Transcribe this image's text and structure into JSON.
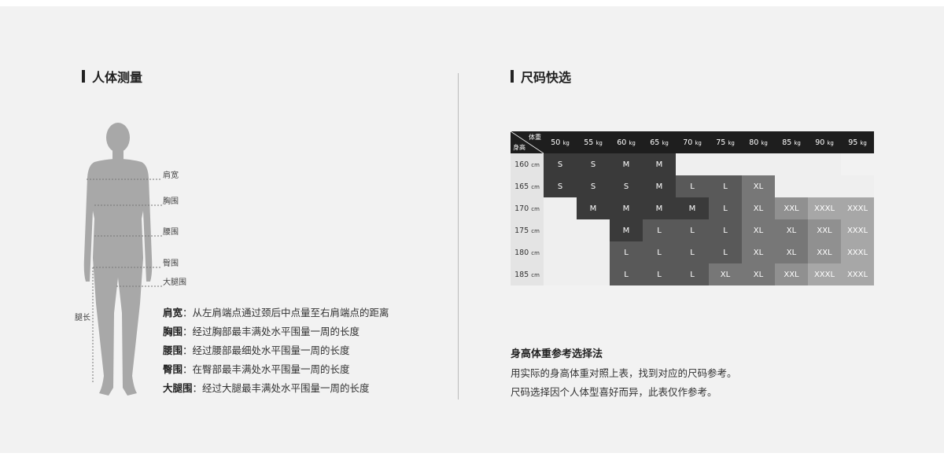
{
  "left": {
    "title": "人体测量",
    "labels": {
      "shoulder": "肩宽",
      "chest": "胸围",
      "waist": "腰围",
      "hip": "臀围",
      "thigh": "大腿围",
      "leg": "腿长"
    },
    "descriptions": [
      {
        "term": "肩宽",
        "text": "：从左肩端点通过颈后中点量至右肩端点的距离"
      },
      {
        "term": "胸围",
        "text": "：经过胸部最丰满处水平围量一周的长度"
      },
      {
        "term": "腰围",
        "text": "：经过腰部最细处水平围量一周的长度"
      },
      {
        "term": "臀围",
        "text": "：在臀部最丰满处水平围量一周的长度"
      },
      {
        "term": "大腿围",
        "text": "：经过大腿最丰满处水平围量一周的长度"
      }
    ]
  },
  "right": {
    "title": "尺码快选",
    "corner_weight": "体重",
    "corner_height": "身高",
    "weights": [
      "50",
      "55",
      "60",
      "65",
      "70",
      "75",
      "80",
      "85",
      "90",
      "95"
    ],
    "weight_unit": "kg",
    "height_unit": "cm",
    "rows": [
      {
        "height": "160",
        "cells": [
          "S",
          "S",
          "M",
          "M",
          "",
          "",
          "",
          "",
          "",
          ""
        ]
      },
      {
        "height": "165",
        "cells": [
          "S",
          "S",
          "S",
          "M",
          "L",
          "L",
          "XL",
          "",
          "",
          ""
        ]
      },
      {
        "height": "170",
        "cells": [
          "",
          "M",
          "M",
          "M",
          "M",
          "L",
          "XL",
          "XXL",
          "XXXL",
          "XXXL"
        ]
      },
      {
        "height": "175",
        "cells": [
          "",
          "",
          "M",
          "L",
          "L",
          "L",
          "XL",
          "XL",
          "XXL",
          "XXXL"
        ]
      },
      {
        "height": "180",
        "cells": [
          "",
          "",
          "L",
          "L",
          "L",
          "L",
          "XL",
          "XL",
          "XXL",
          "XXXL"
        ]
      },
      {
        "height": "185",
        "cells": [
          "",
          "",
          "L",
          "L",
          "L",
          "XL",
          "XL",
          "XXL",
          "XXXL",
          "XXXL"
        ]
      }
    ],
    "method_title": "身高体重参考选择法",
    "method_lines": [
      "用实际的身高体重对照上表，找到对应的尺码参考。",
      "尺码选择因个人体型喜好而异，此表仅作参考。"
    ]
  },
  "colors": {
    "dark": "#1e1e1e",
    "panel": "#f2f2f2",
    "figure": "#a8a8a8"
  }
}
